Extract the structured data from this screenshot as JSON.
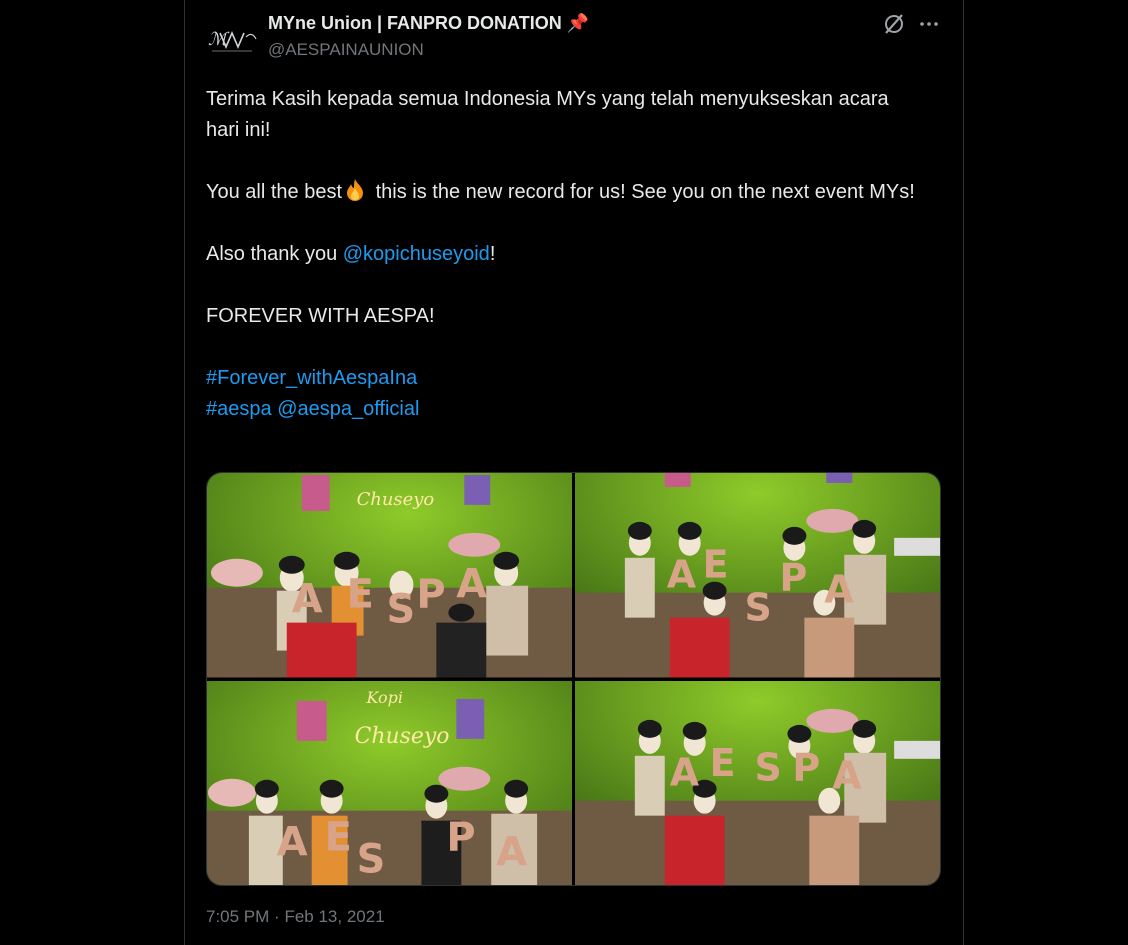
{
  "tweet": {
    "display_name": "MYne Union | FANPRO DONATION",
    "pin_emoji": "📌",
    "handle": "@AESPAINAUNION",
    "line1": "Terima Kasih kepada semua Indonesia MYs yang telah menyukseskan acara hari ini!",
    "line2_pre": "You all the best",
    "line2_post": " this is the new record for us! See you on the next event MYs!",
    "line3_pre": "Also thank you ",
    "line3_mention": "@kopichuseyoid",
    "line3_post": "!",
    "line4": "FOREVER WITH AESPA!",
    "hashtag1": "#Forever_withAespaIna",
    "hashtag2": "#aespa",
    "mention2": "@aespa_official",
    "time": "7:05 PM",
    "separator": "·",
    "date": "Feb 13, 2021"
  },
  "photo_texts": {
    "neon_sign_1": "Kopi",
    "neon_sign_2": "Chuseyo",
    "balloon_letters": [
      "A",
      "E",
      "S",
      "P",
      "A"
    ]
  },
  "colors": {
    "accent": "#1d9bf0",
    "text": "#e7e9ea",
    "muted": "#71767b",
    "background": "#000000",
    "border": "#2f3336",
    "wall_green": "#5f9a1f",
    "balloon": "#d7a48a"
  },
  "icons": {
    "grok": "grok-icon",
    "more": "more-icon",
    "flame": "fire-emoji",
    "avatar": "avatar-logo"
  }
}
